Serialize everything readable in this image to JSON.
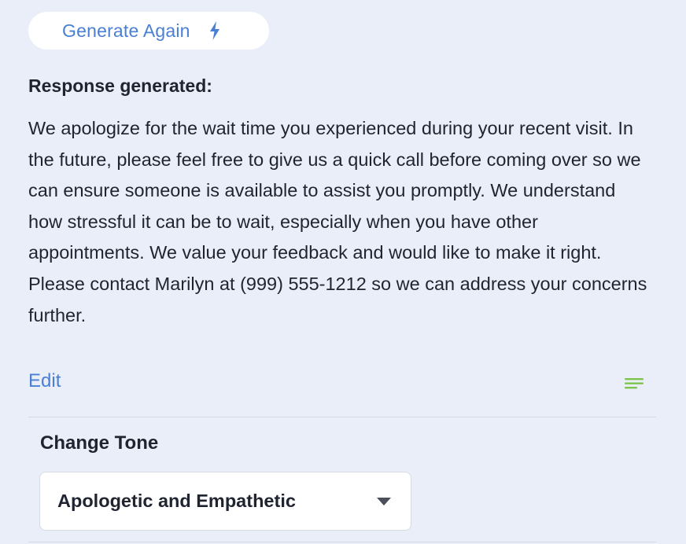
{
  "generate_button": {
    "label": "Generate Again",
    "icon": "lightning-bolt-icon"
  },
  "response": {
    "heading": "Response generated:",
    "text": "We apologize for the wait time you experienced during your recent visit. In the future, please feel free to give us a quick call before coming over so we can ensure someone is available to assist you promptly. We understand how stressful it can be to wait, especially when you have other appointments. We value your feedback and would like to make it right. Please contact Marilyn at (999) 555-1212 so we can address your concerns further.",
    "edit_label": "Edit",
    "lines_icon": "text-lines-icon"
  },
  "tone": {
    "label": "Change Tone",
    "selected": "Apologetic and Empathetic",
    "caret_icon": "caret-down-icon"
  },
  "colors": {
    "background": "#e9eef8",
    "accent_blue": "#4a7fd4",
    "accent_green": "#7cc54a",
    "text": "#1f2430"
  }
}
